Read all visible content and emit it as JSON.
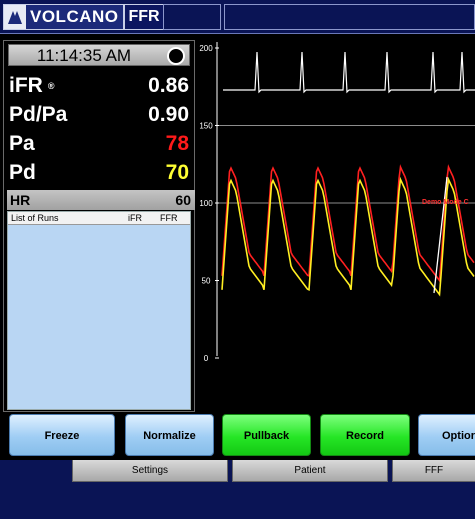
{
  "brand": {
    "name": "VOLCANO",
    "product": "FFR"
  },
  "panel": {
    "time": "11:14:35 AM",
    "metrics": [
      {
        "label": "iFR",
        "sup": "®",
        "value": "0.86",
        "color": "#ffffff"
      },
      {
        "label": "Pd/Pa",
        "value": "0.90",
        "color": "#ffffff"
      },
      {
        "label": "Pa",
        "value": "78",
        "color": "#ff1a1a"
      },
      {
        "label": "Pd",
        "value": "70",
        "color": "#ffff33"
      }
    ],
    "hr": {
      "label": "HR",
      "value": "60"
    },
    "runs": {
      "col_title": "List of Runs",
      "col_ifr": "iFR",
      "col_ffr": "FFR"
    }
  },
  "chart_data": {
    "type": "line",
    "y_ticks": [
      "200",
      "150",
      "100",
      "50",
      "0"
    ],
    "ylim": [
      0,
      200
    ],
    "annotation": "Demo Mode C",
    "series": [
      {
        "color": "#ff2020",
        "description": "aortic pressure (Pa) waveform"
      },
      {
        "color": "#ffee22",
        "description": "distal pressure (Pd) waveform"
      },
      {
        "color": "#ffffff",
        "description": "ECG trace"
      }
    ]
  },
  "buttons": [
    {
      "label": "Freeze",
      "style": "blue"
    },
    {
      "label": "Normalize",
      "style": "blue"
    },
    {
      "label": "Pullback",
      "style": "green"
    },
    {
      "label": "Record",
      "style": "green"
    },
    {
      "label": "Optior",
      "style": "blue"
    }
  ],
  "tabs": [
    {
      "label": "Settings"
    },
    {
      "label": "Patient"
    },
    {
      "label": "FFF"
    }
  ]
}
